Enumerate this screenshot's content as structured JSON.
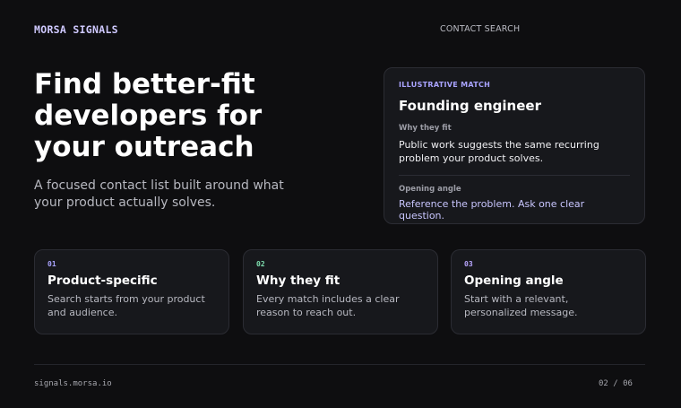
{
  "header": {
    "brand": "MORSA SIGNALS",
    "nav_link": "CONTACT SEARCH"
  },
  "hero": {
    "title": "Find better-fit developers for your outreach",
    "subtitle": "A focused contact list built around what your product actually solves."
  },
  "match_card": {
    "eyebrow": "ILLUSTRATIVE MATCH",
    "title": "Founding engineer",
    "why_label": "Why they fit",
    "why_text": "Public work suggests the same recurring problem your product solves.",
    "angle_label": "Opening angle",
    "angle_text": "Reference the problem. Ask one clear question."
  },
  "features": [
    {
      "num": "01",
      "title": "Product-specific",
      "text": "Search starts from your product and audience.",
      "accent": "#a9a3ff"
    },
    {
      "num": "02",
      "title": "Why they fit",
      "text": "Every match includes a clear reason to reach out.",
      "accent": "#7fe0b0"
    },
    {
      "num": "03",
      "title": "Opening angle",
      "text": "Start with a relevant, personalized message.",
      "accent": "#b9a6ff"
    }
  ],
  "footer": {
    "url": "signals.morsa.io",
    "page": "02 / 06"
  },
  "colors": {
    "background": "#0e0e10",
    "card": "#17181c",
    "accent": "#a9a3ff"
  }
}
